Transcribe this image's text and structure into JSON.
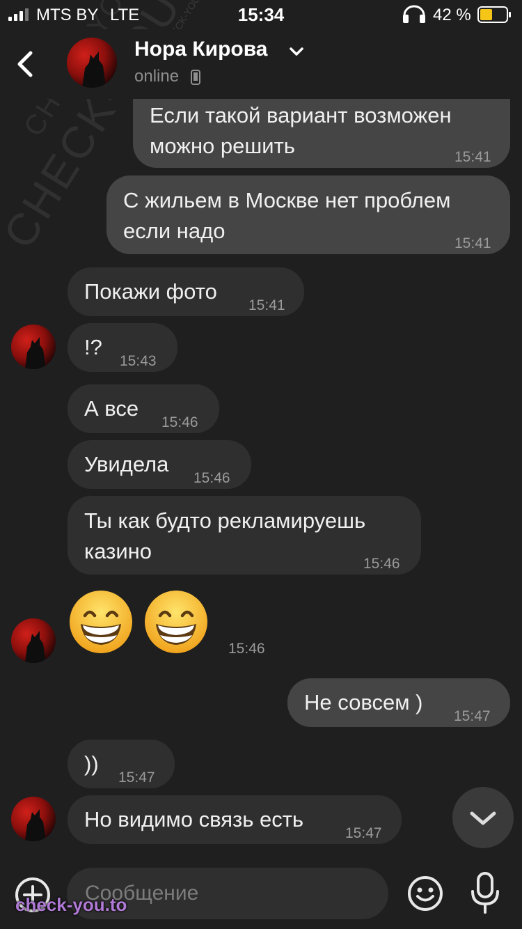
{
  "status_bar": {
    "carrier": "MTS BY",
    "network": "LTE",
    "time": "15:34",
    "battery_percent": "42 %"
  },
  "header": {
    "contact_name": "Нора Кирова",
    "status": "online"
  },
  "messages": [
    {
      "direction": "out",
      "text": "Если такой вариант возможен\nможно решить",
      "time": "15:41"
    },
    {
      "direction": "out",
      "text": "С жильем в Москве нет проблем\nесли надо",
      "time": "15:41"
    },
    {
      "direction": "in",
      "text": "Покажи фото",
      "time": "15:41"
    },
    {
      "direction": "in",
      "text": "!?",
      "time": "15:43"
    },
    {
      "direction": "in",
      "text": "А все",
      "time": "15:46"
    },
    {
      "direction": "in",
      "text": "Увидела",
      "time": "15:46"
    },
    {
      "direction": "in",
      "text": "Ты как будто рекламируешь\nказино",
      "time": "15:46"
    },
    {
      "direction": "in",
      "emoji": [
        "😁",
        "😁"
      ],
      "time": "15:46"
    },
    {
      "direction": "out",
      "text": "Не совсем )",
      "time": "15:47"
    },
    {
      "direction": "in",
      "text": "))",
      "time": "15:47"
    },
    {
      "direction": "in",
      "text": "Но видимо связь есть",
      "time": "15:47"
    }
  ],
  "input": {
    "placeholder": "Сообщение"
  },
  "icons": {
    "back": "chevron-left-icon",
    "expand": "chevron-down-icon",
    "device": "phone-icon",
    "attach": "plus-circle-icon",
    "emoji": "smiley-icon",
    "mic": "microphone-icon",
    "scroll": "chevron-down-icon"
  },
  "watermarks": {
    "diagonal": "CHECK-YOU.ME",
    "footer": "check-you.to"
  }
}
